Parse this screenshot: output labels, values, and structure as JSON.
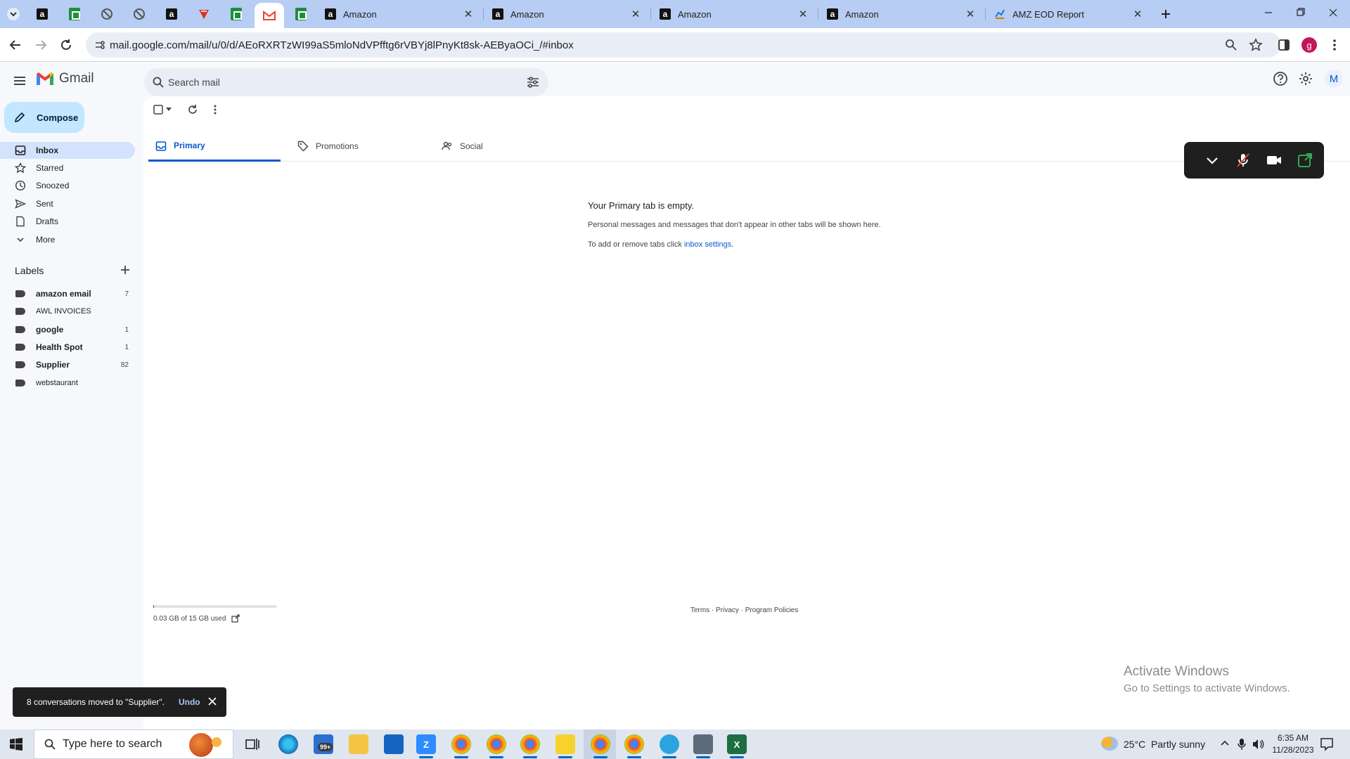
{
  "browser": {
    "tabs": [
      {
        "title": "Amazon",
        "close": "✕"
      },
      {
        "title": "Amazon",
        "close": "✕"
      },
      {
        "title": "Amazon",
        "close": "✕"
      },
      {
        "title": "Amazon",
        "close": "✕"
      },
      {
        "title": "AMZ EOD Report",
        "close": "✕"
      }
    ],
    "url": "mail.google.com/mail/u/0/d/AEoRXRTzWI99aS5mloNdVPfftg6rVBYj8lPnyKt8sk-AEByaOCi_/#inbox",
    "profile_initial": "g"
  },
  "gmail": {
    "logo_text": "Gmail",
    "search_placeholder": "Search mail",
    "compose_label": "Compose",
    "nav": [
      {
        "label": "Inbox"
      },
      {
        "label": "Starred"
      },
      {
        "label": "Snoozed"
      },
      {
        "label": "Sent"
      },
      {
        "label": "Drafts"
      },
      {
        "label": "More"
      }
    ],
    "labels_heading": "Labels",
    "labels": [
      {
        "name": "amazon email",
        "count": "7"
      },
      {
        "name": "AWL INVOICES",
        "count": ""
      },
      {
        "name": "google",
        "count": "1"
      },
      {
        "name": "Health Spot",
        "count": "1"
      },
      {
        "name": "Supplier",
        "count": "82"
      },
      {
        "name": "webstaurant",
        "count": ""
      }
    ],
    "tabs": [
      {
        "label": "Primary"
      },
      {
        "label": "Promotions"
      },
      {
        "label": "Social"
      }
    ],
    "empty": {
      "title": "Your Primary tab is empty.",
      "line1": "Personal messages and messages that don't appear in other tabs will be shown here.",
      "line2_prefix": "To add or remove tabs click ",
      "line2_link": "inbox settings",
      "line2_suffix": "."
    },
    "storage": "0.03 GB of 15 GB used",
    "storage_fraction": 0.002,
    "footer": "Terms · Privacy · Program Policies",
    "snackbar": {
      "message": "8 conversations moved to \"Supplier\".",
      "action": "Undo"
    },
    "account_initial": "M"
  },
  "watermark": {
    "line1": "Activate Windows",
    "line2": "Go to Settings to activate Windows."
  },
  "taskbar": {
    "search_placeholder": "Type here to search",
    "weather": "25°C  Partly sunny",
    "time": "6:35 AM",
    "date": "11/28/2023",
    "badge_mail": "99+"
  },
  "colors": {
    "accent": "#0b57d0",
    "compose_bg": "#c2e7ff",
    "active_nav": "#d3e3fd",
    "tabstrip": "#b7cdf3"
  }
}
